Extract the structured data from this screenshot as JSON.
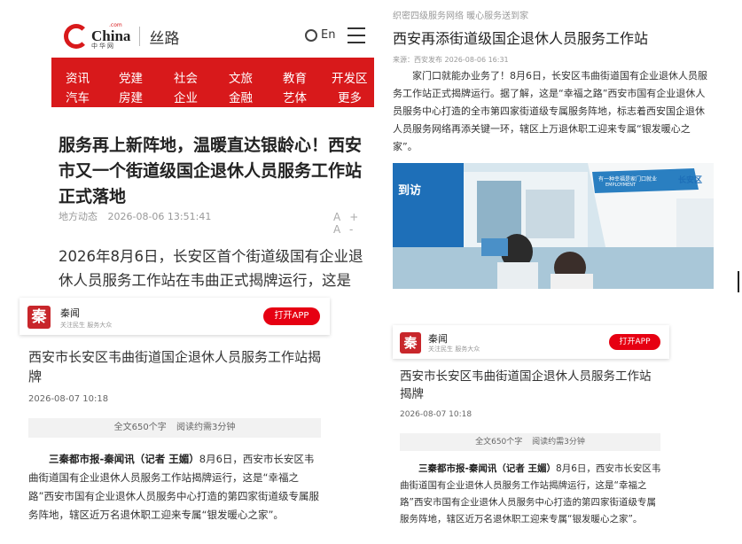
{
  "panel1": {
    "logo_en": "China",
    "logo_dot": ".com",
    "logo_zh": "中华网",
    "channel": "丝路",
    "lang": "En",
    "nav": [
      [
        "资讯",
        "党建",
        "社会",
        "文旅",
        "教育",
        "开发区"
      ],
      [
        "汽车",
        "房建",
        "企业",
        "金融",
        "艺体",
        "更多"
      ]
    ],
    "headline": "服务再上新阵地，温暖直达银龄心！西安市又一个街道级国企退休人员服务工作站正式落地",
    "section": "地方动态",
    "datetime": "2026-08-06 13:51:41",
    "font_controls": "A+ A-",
    "body": "2026年8月6日，长安区首个街道级国有企业退休人员服务工作站在韦曲正式揭牌运行，这是"
  },
  "app_card": {
    "icon_char": "秦",
    "name": "秦闻",
    "slogan": "关注民生 服务大众",
    "open_label": "打开APP"
  },
  "article": {
    "title": "西安市长安区韦曲街道国企退休人员服务工作站揭牌",
    "date": "2026-08-07 10:18",
    "word_count": "全文650个字",
    "read_time": "阅读约需3分钟",
    "lead_bold": "三秦都市报-秦闻讯（记者 王媚）",
    "body": "8月6日，西安市长安区韦曲街道国有企业退休人员服务工作站揭牌运行，这是“幸福之路”西安市国有企业退休人员服务中心打造的第四家街道级专属服务阵地，辖区近万名退休职工迎来专属“银发暖心之家”。"
  },
  "panel3": {
    "crumb": "织密四级服务网络 暖心服务送到家",
    "title": "西安再添街道级国企退休人员服务工作站",
    "source": "来源：西安发布 2026-08-06 16:31",
    "body": "家门口就能办业务了！8月6日，长安区韦曲街道国有企业退休人员服务工作站正式揭牌运行。据了解，这是“幸福之路”西安市国有企业退休人员服务中心打造的全市第四家街道级专属服务阵地，标志着西安国企退休人员服务网络再添关键一环，辖区上万退休职工迎来专属“银发暖心之家”。",
    "photo_sign": "到访",
    "photo_banner": "有一种幸福是家门口就业",
    "photo_banner_en": "EMPLOYMENT",
    "photo_district": "长安区"
  },
  "colors": {
    "brand_red": "#d8191b",
    "app_red": "#e60012"
  }
}
